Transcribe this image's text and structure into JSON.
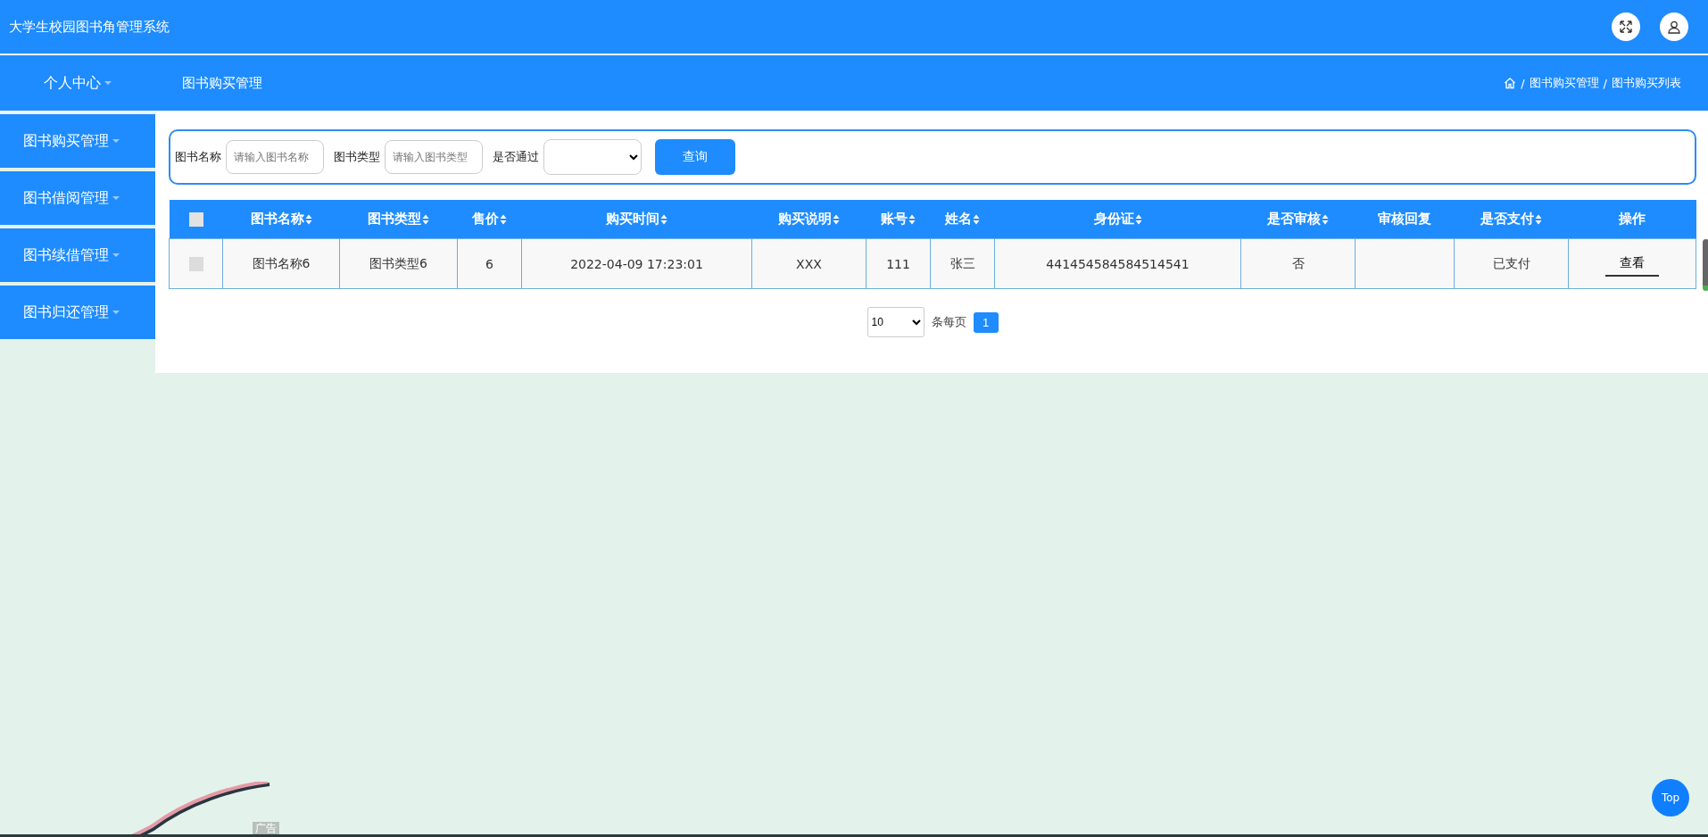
{
  "header": {
    "title": "大学生校园图书角管理系统"
  },
  "nav": {
    "user_menu": "个人中心",
    "page_title": "图书购买管理",
    "breadcrumb": [
      {
        "separator": "/",
        "label": "图书购买管理"
      },
      {
        "separator": "/",
        "label": "图书购买列表"
      }
    ]
  },
  "sidebar": {
    "items": [
      {
        "label": "图书购买管理"
      },
      {
        "label": "图书借阅管理"
      },
      {
        "label": "图书续借管理"
      },
      {
        "label": "图书归还管理"
      }
    ]
  },
  "search": {
    "fields": [
      {
        "kind": "text",
        "label": "图书名称",
        "placeholder": "请输入图书名称"
      },
      {
        "kind": "text",
        "label": "图书类型",
        "placeholder": "请输入图书类型"
      },
      {
        "kind": "select",
        "label": "是否通过"
      }
    ],
    "button": "查询"
  },
  "table": {
    "all_checked": false,
    "columns": [
      {
        "label": "图书名称",
        "sortable": true
      },
      {
        "label": "图书类型",
        "sortable": true
      },
      {
        "label": "售价",
        "sortable": true
      },
      {
        "label": "购买时间",
        "sortable": true
      },
      {
        "label": "购买说明",
        "sortable": true
      },
      {
        "label": "账号",
        "sortable": true
      },
      {
        "label": "姓名",
        "sortable": true
      },
      {
        "label": "身份证",
        "sortable": true
      },
      {
        "label": "是否审核",
        "sortable": true
      },
      {
        "label": "审核回复",
        "sortable": false
      },
      {
        "label": "是否支付",
        "sortable": true
      },
      {
        "label": "操作",
        "sortable": false
      }
    ],
    "rows": [
      {
        "checked": false,
        "cells": [
          "图书名称6",
          "图书类型6",
          "6",
          "2022-04-09 17:23:01",
          "XXX",
          "111",
          "张三",
          "441454584584514541",
          "否",
          "",
          "已支付"
        ],
        "action": "查看"
      }
    ]
  },
  "pagination": {
    "page_size": "10",
    "page_size_label": "条每页",
    "pages": [
      {
        "label": "1",
        "selected": true
      }
    ]
  },
  "ad_label": "广告",
  "top_button": "Top"
}
